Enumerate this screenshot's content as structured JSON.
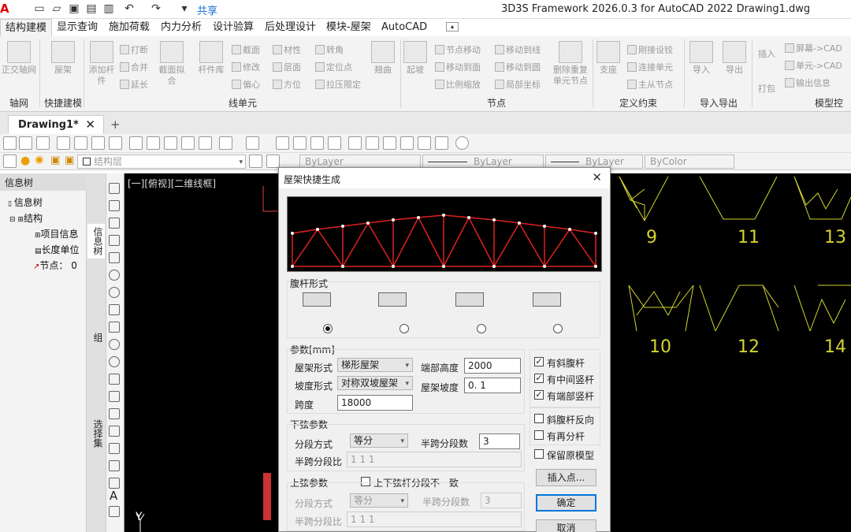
{
  "title_bar": {
    "app_logo": "A",
    "share": "共享",
    "window_title": "3D3S Framework 2026.0.3 for AutoCAD 2022    Drawing1.dwg"
  },
  "ribbon_tabs": [
    "结构建模",
    "显示查询",
    "施加荷载",
    "内力分析",
    "设计验算",
    "后处理设计",
    "模块-屋架",
    "AutoCAD"
  ],
  "ribbon": {
    "axis": {
      "label": "正交轴网",
      "group": "轴网"
    },
    "quick": {
      "label": "屋架",
      "group": "快捷建模"
    },
    "line_items": [
      "添加杆件",
      "打断",
      "合并",
      "延长",
      "截面拟合",
      "杆件库",
      "截面",
      "修改",
      "偏心",
      "材性",
      "层面",
      "方位",
      "转角",
      "定位点",
      "拉压限定",
      "翘曲"
    ],
    "line_group": "线单元",
    "node_items": [
      "起坡",
      "节点移动",
      "移动到面",
      "比例缩放",
      "移动到线",
      "移动到圆",
      "局部坐标",
      "删除重复单元节点"
    ],
    "node_group": "节点",
    "constraint_items": [
      "支座",
      "刚接设铰",
      "连接单元",
      "主从节点"
    ],
    "constraint_group": "定义约束",
    "io_items": [
      "导入",
      "导出"
    ],
    "io_group": "导入导出",
    "model_items": [
      "插入",
      "打包",
      "屏幕->CAD",
      "单元->CAD",
      "输出信息"
    ],
    "model_group": "模型控制"
  },
  "doc_tab": {
    "name": "Drawing1*",
    "close": "✕",
    "add": "+"
  },
  "layer_bar": {
    "layer": "结构层",
    "linetype1": "ByLayer",
    "linetype2": "ByLayer",
    "linetype3": "ByLayer",
    "color": "ByColor"
  },
  "left_panel": {
    "header": "信息树",
    "tree": [
      "信息树",
      "结构",
      "项目信息",
      "长度单位",
      "节点：  0"
    ]
  },
  "vertical_tabs": [
    "信息树",
    "组",
    "选择集"
  ],
  "viewport": {
    "label": "[一][俯视][二维线框]",
    "axis_label": "Y"
  },
  "truss_labels": [
    "9",
    "11",
    "13",
    "10",
    "12",
    "14"
  ],
  "dialog": {
    "title": "屋架快捷生成",
    "close": "✕",
    "web_section": "腹杆形式",
    "params_section": "参数[mm]",
    "truss_type_label": "屋架形式",
    "truss_type": "梯形屋架",
    "slope_type_label": "坡度形式",
    "slope_type": "对称双坡屋架",
    "span_label": "跨度",
    "span": "18000",
    "end_height_label": "端部高度",
    "end_height": "2000",
    "slope_label": "屋架坡度",
    "slope": "0. 1",
    "bottom_section": "下弦参数",
    "bottom_seg_method_label": "分段方式",
    "bottom_seg_method": "等分",
    "bottom_half_seg_label": "半跨分段数",
    "bottom_half_seg": "3",
    "bottom_ratio_label": "半跨分段比",
    "bottom_ratio": "1 1 1",
    "top_section": "上弦参数",
    "top_mismatch": "上下弦杆分段不一致",
    "top_seg_method_label": "分段方式",
    "top_seg_method": "等分",
    "top_half_seg_label": "半跨分段数",
    "top_half_seg": "3",
    "top_ratio_label": "半跨分段比",
    "top_ratio": "1 1 1",
    "checks": [
      "有斜腹杆",
      "有中间竖杆",
      "有端部竖杆",
      "斜腹杆反向",
      "有再分杆",
      "保留原模型"
    ],
    "insert_point": "插入点...",
    "ok": "确定",
    "cancel": "取消"
  }
}
